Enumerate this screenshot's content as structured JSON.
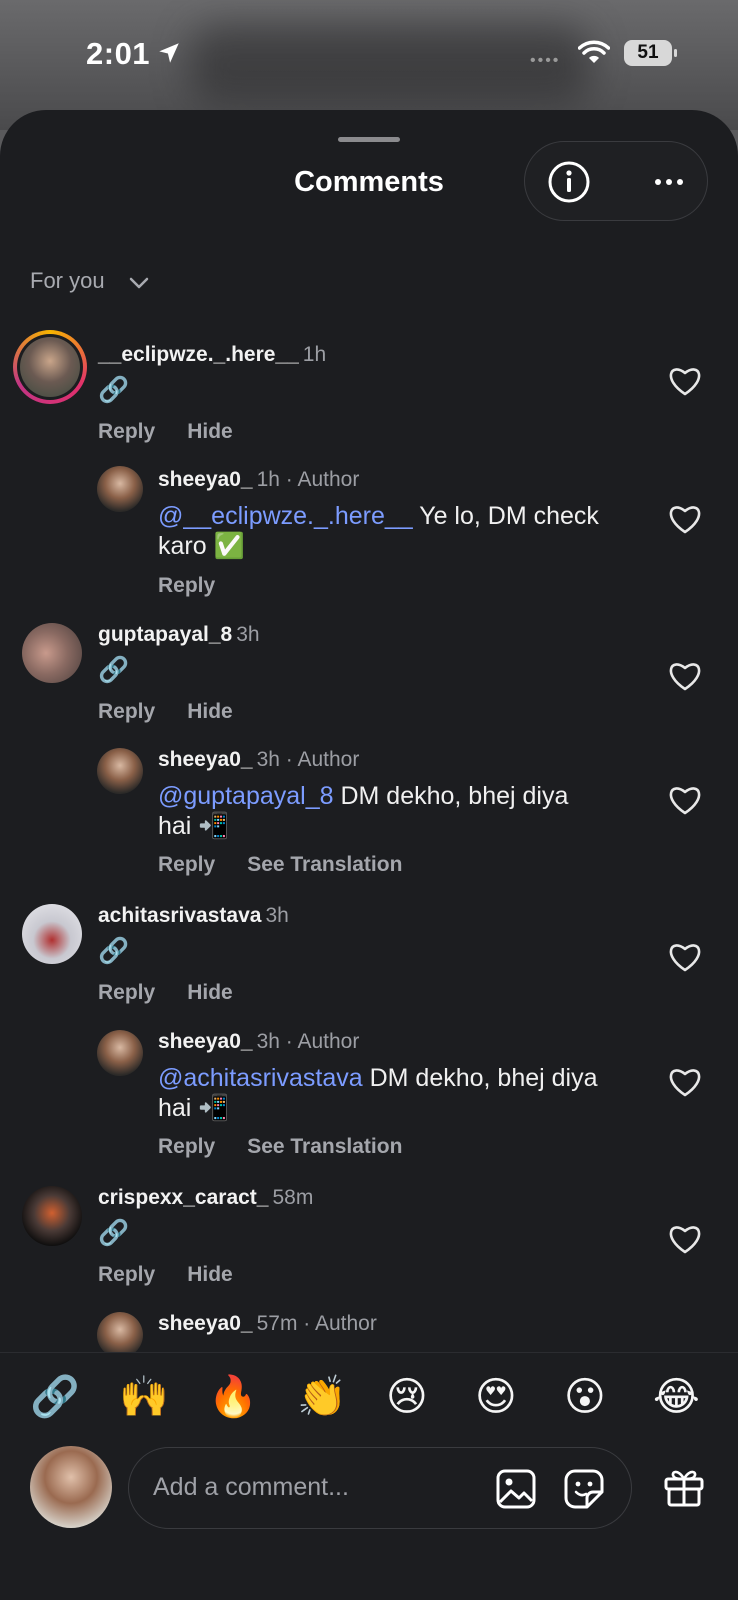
{
  "status_bar": {
    "time": "2:01",
    "battery": "51"
  },
  "header": {
    "title": "Comments",
    "filter_label": "For you"
  },
  "comments": [
    {
      "user": "__eclipwze._.here__",
      "time": "1h",
      "text": "🔗",
      "actions": [
        "Reply",
        "Hide"
      ]
    },
    {
      "user": "sheeya0_",
      "time": "1h · Author",
      "mention": "@__eclipwze._.here__",
      "text_line1": " Ye lo, DM check",
      "text_line2": "karo ✅",
      "actions": [
        "Reply"
      ]
    },
    {
      "user": "guptapayal_8",
      "time": "3h",
      "text": "🔗",
      "actions": [
        "Reply",
        "Hide"
      ]
    },
    {
      "user": "sheeya0_",
      "time": "3h · Author",
      "mention": "@guptapayal_8",
      "text_line1": " DM dekho, bhej diya",
      "text_line2": "hai 📲",
      "actions": [
        "Reply",
        "See Translation"
      ]
    },
    {
      "user": "achitasrivastava",
      "time": "3h",
      "text": "🔗",
      "actions": [
        "Reply",
        "Hide"
      ]
    },
    {
      "user": "sheeya0_",
      "time": "3h · Author",
      "mention": "@achitasrivastava",
      "text_line1": " DM dekho, bhej diya",
      "text_line2": "hai 📲",
      "actions": [
        "Reply",
        "See Translation"
      ]
    },
    {
      "user": "crispexx_caract_",
      "time": "58m",
      "text": "🔗",
      "actions": [
        "Reply",
        "Hide"
      ]
    },
    {
      "user": "sheeya0_",
      "time": "57m · Author"
    }
  ],
  "reactions": [
    "🔗",
    "🙌",
    "🔥",
    "👏",
    "😢",
    "😍",
    "😮",
    "😂"
  ],
  "composer": {
    "placeholder": "Add a comment..."
  },
  "colors": {
    "background": "#1c1d20",
    "mention": "#7c9cff",
    "muted": "#a4a6ac"
  },
  "icons": [
    "location-arrow-icon",
    "wifi-icon",
    "info-icon",
    "more-icon",
    "chevron-down-icon",
    "heart-icon",
    "image-icon",
    "sticker-icon",
    "gift-icon"
  ]
}
